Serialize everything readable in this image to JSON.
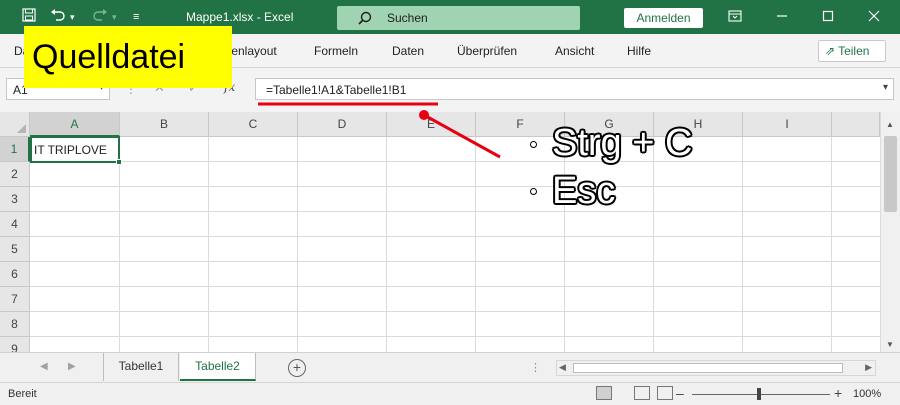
{
  "window": {
    "file_title": "Mappe1.xlsx  -  Excel",
    "search_label": "Suchen",
    "signin_label": "Anmelden"
  },
  "ribbon": {
    "tabs": [
      "Da",
      "tenlayout",
      "Formeln",
      "Daten",
      "Überprüfen",
      "Ansicht",
      "Hilfe"
    ],
    "share_label": "Teilen"
  },
  "formula_bar": {
    "name_box": "A1",
    "fx_label": "fx",
    "formula": "=Tabelle1!A1&Tabelle1!B1"
  },
  "grid": {
    "columns": [
      "A",
      "B",
      "C",
      "D",
      "E",
      "F",
      "G",
      "H",
      "I"
    ],
    "rows": [
      "1",
      "2",
      "3",
      "4",
      "5",
      "6",
      "7",
      "8",
      "9"
    ],
    "cell_a1": "IT TRIPLOVE"
  },
  "sheets": {
    "tabs": [
      "Tabelle1",
      "Tabelle2"
    ],
    "active": "Tabelle2"
  },
  "status": {
    "ready": "Bereit",
    "zoom": "100%"
  },
  "annotation": {
    "label": "Quelldatei",
    "step1": "Strg + C",
    "step2": "Esc",
    "colors": {
      "label_bg": "#ffff00",
      "arrow": "#e60012"
    }
  },
  "colors": {
    "excel_green": "#217346"
  }
}
